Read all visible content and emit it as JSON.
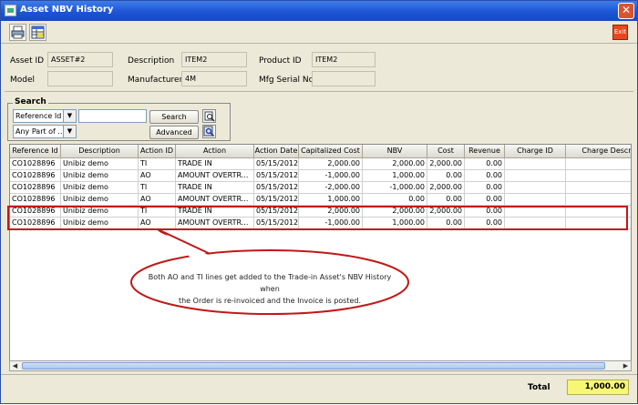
{
  "window": {
    "title": "Asset NBV History",
    "close_glyph": "✕"
  },
  "toolbar": {
    "exit_label": "Exit"
  },
  "form": {
    "asset_id_label": "Asset ID",
    "asset_id_value": "ASSET#2",
    "description_label": "Description",
    "description_value": "ITEM2",
    "product_id_label": "Product ID",
    "product_id_value": "ITEM2",
    "model_label": "Model",
    "model_value": "",
    "manufacturer_label": "Manufacturer",
    "manufacturer_value": "4M",
    "mfg_serial_label": "Mfg Serial No",
    "mfg_serial_value": ""
  },
  "search": {
    "title": "Search",
    "field_select": "Reference Id",
    "match_select": "Any Part of ...",
    "query_value": "",
    "search_button": "Search",
    "advanced_button": "Advanced"
  },
  "table": {
    "headers": [
      "Reference Id",
      "Description",
      "Action ID",
      "Action",
      "Action Date",
      "Capitalized Cost",
      "NBV",
      "Cost",
      "Revenue",
      "Charge ID",
      "Charge Descr"
    ],
    "rows": [
      [
        "CO1028896",
        "Unibiz demo",
        "TI",
        "TRADE IN",
        "05/15/2012",
        "2,000.00",
        "2,000.00",
        "2,000.00",
        "0.00",
        "",
        ""
      ],
      [
        "CO1028896",
        "Unibiz demo",
        "AO",
        "AMOUNT OVERTR...",
        "05/15/2012",
        "-1,000.00",
        "1,000.00",
        "0.00",
        "0.00",
        "",
        ""
      ],
      [
        "CO1028896",
        "Unibiz demo",
        "TI",
        "TRADE IN",
        "05/15/2012",
        "-2,000.00",
        "-1,000.00",
        "2,000.00",
        "0.00",
        "",
        ""
      ],
      [
        "CO1028896",
        "Unibiz demo",
        "AO",
        "AMOUNT OVERTR...",
        "05/15/2012",
        "1,000.00",
        "0.00",
        "0.00",
        "0.00",
        "",
        ""
      ],
      [
        "CO1028896",
        "Unibiz demo",
        "TI",
        "TRADE IN",
        "05/15/2012",
        "2,000.00",
        "2,000.00",
        "2,000.00",
        "0.00",
        "",
        ""
      ],
      [
        "CO1028896",
        "Unibiz demo",
        "AO",
        "AMOUNT OVERTR...",
        "05/15/2012",
        "-1,000.00",
        "1,000.00",
        "0.00",
        "0.00",
        "",
        ""
      ]
    ]
  },
  "callout": {
    "line1": "Both AO and TI lines get added to the Trade-in Asset's NBV History when",
    "line2": "the Order is re-invoiced and the Invoice is posted."
  },
  "footer": {
    "total_label": "Total",
    "total_value": "1,000.00"
  },
  "colors": {
    "title_bar": "#1c55d6",
    "highlight_border": "#c01818",
    "total_bg": "#f7f776"
  }
}
